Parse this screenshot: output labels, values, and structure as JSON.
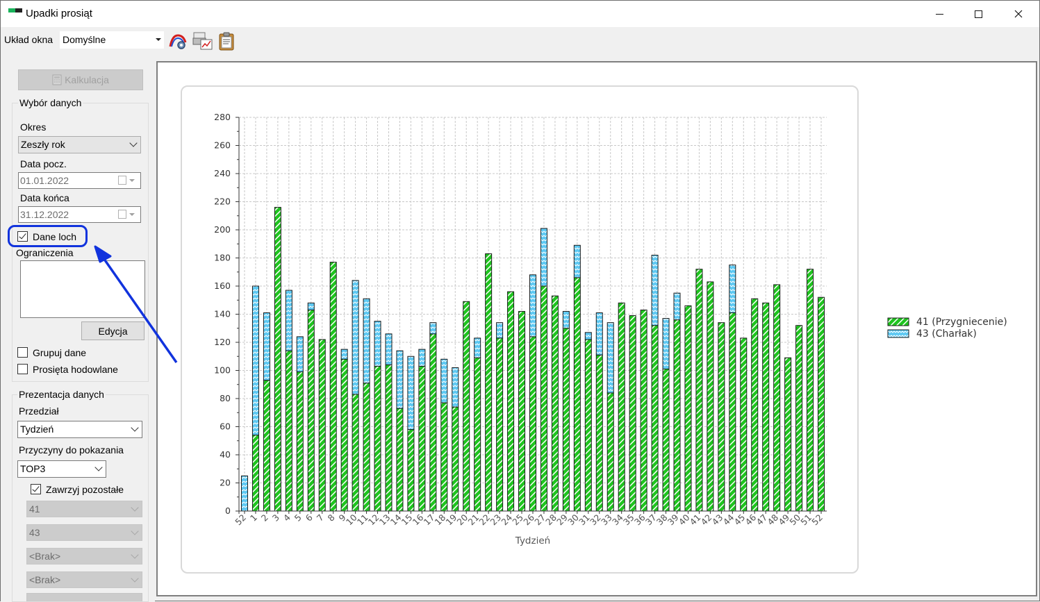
{
  "window": {
    "title": "Upadki prosiąt"
  },
  "toolbar": {
    "layout_label": "Układ okna",
    "layout_value": "Domyślne"
  },
  "sidebar": {
    "calc_button": "Kalkulacja",
    "data_group_title": "Wybór danych",
    "period_label": "Okres",
    "period_value": "Zeszły rok",
    "start_label": "Data pocz.",
    "start_value": "01.01.2022",
    "end_label": "Data końca",
    "end_value": "31.12.2022",
    "sow_data_label": "Dane loch",
    "sow_data_checked": true,
    "restrictions_label": "Ograniczenia",
    "edit_button": "Edycja",
    "group_data_label": "Grupuj dane",
    "group_data_checked": false,
    "breeding_label": "Prosięta hodowlane",
    "breeding_checked": false,
    "presentation_title": "Prezentacja danych",
    "interval_label": "Przedział",
    "interval_value": "Tydzień",
    "reasons_label": "Przyczyny do pokazania",
    "reasons_value": "TOP3",
    "include_others_label": "Zawrzyj pozostałe",
    "include_others_checked": true,
    "reason_slots": [
      "41",
      "43",
      "<Brak>",
      "<Brak>"
    ]
  },
  "chart_data": {
    "type": "bar",
    "stacked": true,
    "xlabel": "Tydzień",
    "ylabel": "",
    "ylim": [
      0,
      280
    ],
    "yticks": [
      0,
      20,
      40,
      60,
      80,
      100,
      120,
      140,
      160,
      180,
      200,
      220,
      240,
      260,
      280
    ],
    "grid": true,
    "legend_position": "right",
    "categories": [
      "52",
      "1",
      "2",
      "3",
      "4",
      "5",
      "6",
      "7",
      "8",
      "9",
      "10",
      "11",
      "12",
      "13",
      "14",
      "15",
      "16",
      "17",
      "18",
      "19",
      "20",
      "21",
      "22",
      "23",
      "24",
      "25",
      "26",
      "27",
      "28",
      "29",
      "30",
      "31",
      "32",
      "33",
      "34",
      "35",
      "36",
      "37",
      "38",
      "39",
      "40",
      "41",
      "42",
      "43",
      "44",
      "45",
      "46",
      "47",
      "48",
      "49",
      "50",
      "51",
      "52"
    ],
    "series": [
      {
        "name": "41 (Przygniecenie)",
        "color": "#1fc41f",
        "values": [
          0,
          54,
          93,
          216,
          114,
          99,
          143,
          122,
          177,
          108,
          83,
          91,
          103,
          104,
          73,
          58,
          103,
          126,
          77,
          74,
          149,
          109,
          183,
          123,
          156,
          142,
          124,
          160,
          153,
          130,
          166,
          122,
          111,
          84,
          148,
          139,
          143,
          132,
          101,
          136,
          146,
          172,
          163,
          134,
          141,
          123,
          151,
          148,
          161,
          109,
          132,
          172,
          152
        ]
      },
      {
        "name": "43 (Charłak)",
        "color": "#5cc8f2",
        "values": [
          25,
          106,
          48,
          0,
          43,
          25,
          5,
          0,
          0,
          7,
          81,
          60,
          32,
          22,
          41,
          52,
          12,
          8,
          31,
          28,
          0,
          14,
          0,
          11,
          0,
          0,
          44,
          41,
          0,
          12,
          23,
          5,
          30,
          50,
          0,
          0,
          0,
          50,
          36,
          19,
          0,
          0,
          0,
          0,
          34,
          0,
          0,
          0,
          0,
          0,
          0,
          0,
          0
        ]
      }
    ]
  },
  "colors": {
    "annotation": "#1133dd",
    "green": "#1fc41f",
    "blue": "#5cc8f2"
  }
}
